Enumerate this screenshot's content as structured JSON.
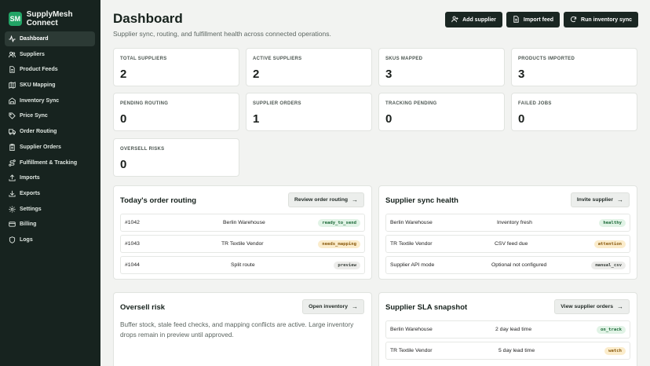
{
  "brand": {
    "badge": "SM",
    "name": "SupplyMesh Connect"
  },
  "nav": [
    {
      "label": "Dashboard",
      "icon": "activity-icon",
      "active": true
    },
    {
      "label": "Suppliers",
      "icon": "users-icon"
    },
    {
      "label": "Product Feeds",
      "icon": "file-icon"
    },
    {
      "label": "SKU Mapping",
      "icon": "map-icon"
    },
    {
      "label": "Inventory Sync",
      "icon": "warehouse-icon"
    },
    {
      "label": "Price Sync",
      "icon": "tag-icon"
    },
    {
      "label": "Order Routing",
      "icon": "truck-icon"
    },
    {
      "label": "Supplier Orders",
      "icon": "clipboard-icon"
    },
    {
      "label": "Fulfillment & Tracking",
      "icon": "route-icon"
    },
    {
      "label": "Imports",
      "icon": "upload-icon"
    },
    {
      "label": "Exports",
      "icon": "download-icon"
    },
    {
      "label": "Settings",
      "icon": "gear-icon"
    },
    {
      "label": "Billing",
      "icon": "credit-card-icon"
    },
    {
      "label": "Logs",
      "icon": "shield-icon"
    }
  ],
  "header": {
    "title": "Dashboard",
    "subtitle": "Supplier sync, routing, and fulfillment health across connected operations.",
    "add_supplier": "Add supplier",
    "import_feed": "Import feed",
    "run_sync": "Run inventory sync"
  },
  "stats": [
    {
      "label": "TOTAL SUPPLIERS",
      "value": "2"
    },
    {
      "label": "ACTIVE SUPPLIERS",
      "value": "2"
    },
    {
      "label": "SKUS MAPPED",
      "value": "3"
    },
    {
      "label": "PRODUCTS IMPORTED",
      "value": "3"
    },
    {
      "label": "PENDING ROUTING",
      "value": "0"
    },
    {
      "label": "SUPPLIER ORDERS",
      "value": "1"
    },
    {
      "label": "TRACKING PENDING",
      "value": "0"
    },
    {
      "label": "FAILED JOBS",
      "value": "0"
    },
    {
      "label": "OVERSELL RISKS",
      "value": "0"
    }
  ],
  "routing": {
    "title": "Today's order routing",
    "button": "Review order routing",
    "rows": [
      {
        "order": "#1042",
        "dest": "Berlin Warehouse",
        "status": "ready_to_send"
      },
      {
        "order": "#1043",
        "dest": "TR Textile Vendor",
        "status": "needs_mapping"
      },
      {
        "order": "#1044",
        "dest": "Split route",
        "status": "preview"
      }
    ]
  },
  "sync_health": {
    "title": "Supplier sync health",
    "button": "Invite supplier",
    "rows": [
      {
        "name": "Berlin Warehouse",
        "detail": "Inventory fresh",
        "status": "healthy"
      },
      {
        "name": "TR Textile Vendor",
        "detail": "CSV feed due",
        "status": "attention"
      },
      {
        "name": "Supplier API mode",
        "detail": "Optional not configured",
        "status": "manual_csv"
      }
    ]
  },
  "oversell": {
    "title": "Oversell risk",
    "button": "Open inventory",
    "text": "Buffer stock, stale feed checks, and mapping conflicts are active. Large inventory drops remain in preview until approved."
  },
  "sla": {
    "title": "Supplier SLA snapshot",
    "button": "View supplier orders",
    "rows": [
      {
        "name": "Berlin Warehouse",
        "lead": "2 day lead time",
        "status": "on_track"
      },
      {
        "name": "TR Textile Vendor",
        "lead": "5 day lead time",
        "status": "watch"
      }
    ]
  },
  "arrow": "→",
  "colors": {
    "sidebar": "#17231f",
    "accent": "#22a466",
    "pill_green": "#e1f3e6",
    "pill_amber": "#fbeccb",
    "pill_grey": "#ececea"
  }
}
